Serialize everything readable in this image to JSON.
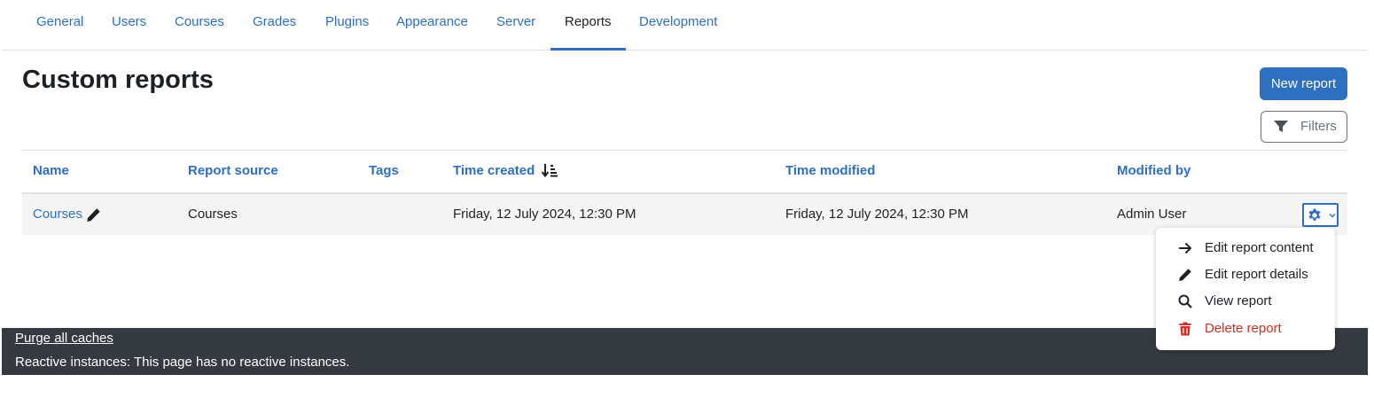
{
  "nav": {
    "tabs": [
      {
        "label": "General"
      },
      {
        "label": "Users"
      },
      {
        "label": "Courses"
      },
      {
        "label": "Grades"
      },
      {
        "label": "Plugins"
      },
      {
        "label": "Appearance"
      },
      {
        "label": "Server"
      },
      {
        "label": "Reports",
        "active": true
      },
      {
        "label": "Development"
      }
    ]
  },
  "page": {
    "title": "Custom reports",
    "new_report_label": "New report",
    "filters_label": "Filters"
  },
  "table": {
    "columns": [
      "Name",
      "Report source",
      "Tags",
      "Time created",
      "Time modified",
      "Modified by"
    ],
    "sorted_column": "Time created",
    "sort_direction": "descending",
    "rows": [
      {
        "name": "Courses",
        "source": "Courses",
        "tags": "",
        "time_created": "Friday, 12 July 2024, 12:30 PM",
        "time_modified": "Friday, 12 July 2024, 12:30 PM",
        "modified_by": "Admin User"
      }
    ]
  },
  "actions_menu": {
    "items": [
      {
        "label": "Edit report content",
        "icon": "arrow-right-icon"
      },
      {
        "label": "Edit report details",
        "icon": "pencil-icon"
      },
      {
        "label": "View report",
        "icon": "search-icon"
      },
      {
        "label": "Delete report",
        "icon": "trash-icon",
        "danger": true
      }
    ]
  },
  "footer": {
    "purge_label": "Purge all caches",
    "reactive_text": "Reactive instances: This page has no reactive instances."
  },
  "colors": {
    "link": "#2f6fc0",
    "primary_button": "#2f6fc0",
    "footer_bg": "#343a40",
    "danger": "#ca3120",
    "row_bg": "#f5f5f5"
  }
}
